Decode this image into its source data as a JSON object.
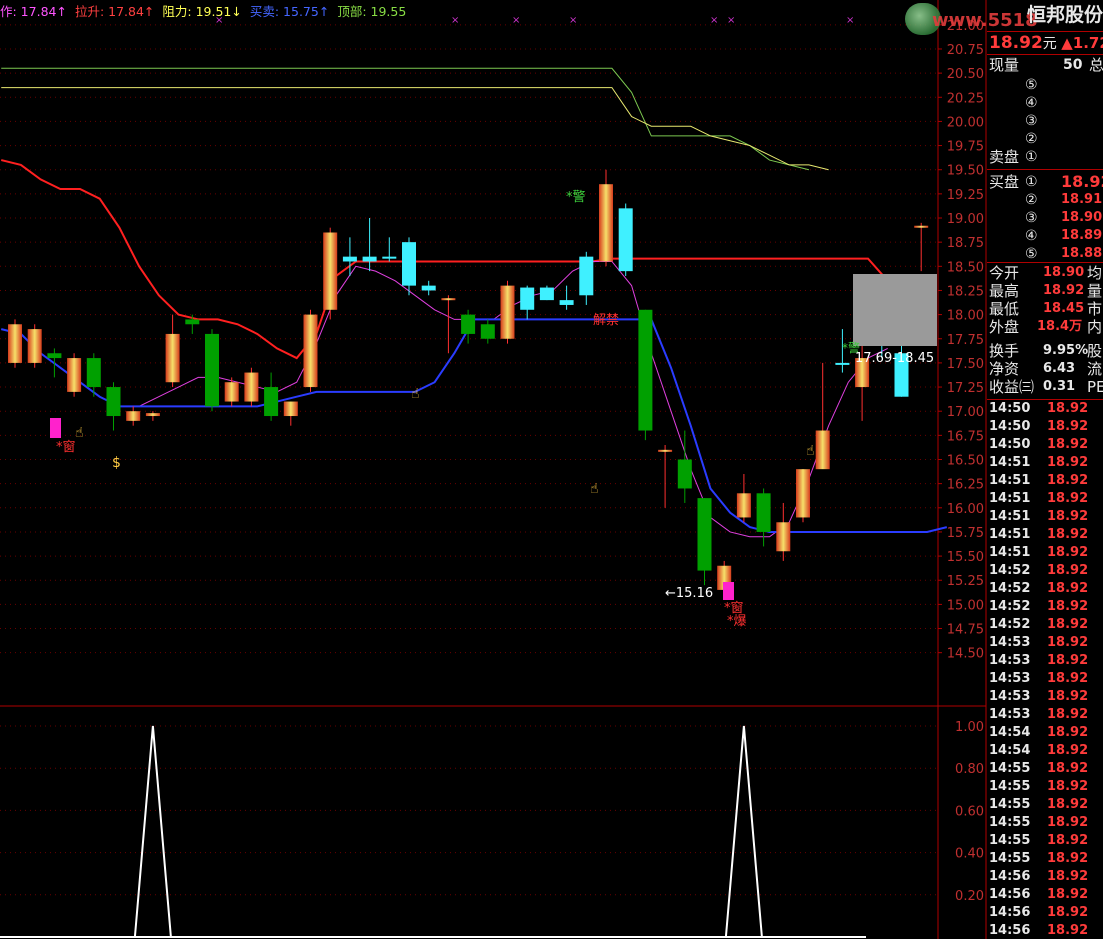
{
  "legend": [
    {
      "text": "作: 17.84↑",
      "color": "#ff55ff"
    },
    {
      "text": "拉升: 17.84↑",
      "color": "#ff4040"
    },
    {
      "text": "阻力: 19.51↓",
      "color": "#ffff55"
    },
    {
      "text": "买卖: 15.75↑",
      "color": "#4466ff"
    },
    {
      "text": "顶部: 19.55",
      "color": "#88dd44"
    }
  ],
  "watermark": "www.5518",
  "stock_name": "恒邦股份",
  "quote": {
    "price": "18.92",
    "unit": "元",
    "change": "▲1.72"
  },
  "volume_row": {
    "label": "现量",
    "value": "50",
    "tail": "总"
  },
  "sell_levels": [
    "⑤",
    "④",
    "③",
    "②",
    "①"
  ],
  "sell_label": "卖盘",
  "buy_label": "买盘",
  "buy_levels": [
    {
      "no": "①",
      "price": "18.92"
    },
    {
      "no": "②",
      "price": "18.91"
    },
    {
      "no": "③",
      "price": "18.90"
    },
    {
      "no": "④",
      "price": "18.89"
    },
    {
      "no": "⑤",
      "price": "18.88"
    }
  ],
  "stats": [
    {
      "label": "今开",
      "value": "18.90",
      "tail": "均",
      "color": "#ff3b3b"
    },
    {
      "label": "最高",
      "value": "18.92",
      "tail": "量",
      "color": "#ff3b3b"
    },
    {
      "label": "最低",
      "value": "18.45",
      "tail": "市",
      "color": "#ff3b3b"
    },
    {
      "label": "外盘",
      "value": "18.4万",
      "tail": "内",
      "color": "#ff3b3b"
    },
    {
      "label": "换手",
      "value": "9.95%",
      "tail": "股",
      "color": "#e8e8e8"
    },
    {
      "label": "净资",
      "value": "6.43",
      "tail": "流",
      "color": "#e8e8e8"
    },
    {
      "label": "收益㈢",
      "value": "0.31",
      "tail": "PE",
      "color": "#e8e8e8"
    }
  ],
  "ticks": [
    {
      "time": "14:50",
      "price": "18.92"
    },
    {
      "time": "14:50",
      "price": "18.92"
    },
    {
      "time": "14:50",
      "price": "18.92"
    },
    {
      "time": "14:51",
      "price": "18.92"
    },
    {
      "time": "14:51",
      "price": "18.92"
    },
    {
      "time": "14:51",
      "price": "18.92"
    },
    {
      "time": "14:51",
      "price": "18.92"
    },
    {
      "time": "14:51",
      "price": "18.92"
    },
    {
      "time": "14:51",
      "price": "18.92"
    },
    {
      "time": "14:52",
      "price": "18.92"
    },
    {
      "time": "14:52",
      "price": "18.92"
    },
    {
      "time": "14:52",
      "price": "18.92"
    },
    {
      "time": "14:52",
      "price": "18.92"
    },
    {
      "time": "14:53",
      "price": "18.92"
    },
    {
      "time": "14:53",
      "price": "18.92"
    },
    {
      "time": "14:53",
      "price": "18.92"
    },
    {
      "time": "14:53",
      "price": "18.92"
    },
    {
      "time": "14:53",
      "price": "18.92"
    },
    {
      "time": "14:54",
      "price": "18.92"
    },
    {
      "time": "14:54",
      "price": "18.92"
    },
    {
      "time": "14:55",
      "price": "18.92"
    },
    {
      "time": "14:55",
      "price": "18.92"
    },
    {
      "time": "14:55",
      "price": "18.92"
    },
    {
      "time": "14:55",
      "price": "18.92"
    },
    {
      "time": "14:55",
      "price": "18.92"
    },
    {
      "time": "14:55",
      "price": "18.92"
    },
    {
      "time": "14:56",
      "price": "18.92"
    },
    {
      "time": "14:56",
      "price": "18.92"
    },
    {
      "time": "14:56",
      "price": "18.92"
    },
    {
      "time": "14:56",
      "price": "18.92"
    }
  ],
  "annotations": {
    "warn1": "*警",
    "warn2": "*警",
    "ban": "解禁",
    "window1": "*窗",
    "window2": "*窗",
    "burst": "*爆",
    "range_label": "17.69-18.45",
    "low_label": "←15.16"
  },
  "colors": {
    "up": "#ff3030",
    "down": "#00a000",
    "cyan": "#3ff0ff",
    "ma_red": "#ff2020",
    "ma_blue": "#2a3cff",
    "ma_magenta": "#e040e0",
    "resist_yellow": "#e8e870",
    "top_green": "#7cc850"
  },
  "chart_data": {
    "type": "candlestick",
    "price_axis": {
      "ticks": [
        "21.00",
        "20.75",
        "20.50",
        "20.25",
        "20.00",
        "19.75",
        "19.50",
        "19.25",
        "19.00",
        "18.75",
        "18.50",
        "18.25",
        "18.00",
        "17.75",
        "17.50",
        "17.25",
        "17.00",
        "16.75",
        "16.50",
        "16.25",
        "16.00",
        "15.75",
        "15.50",
        "15.25",
        "15.00",
        "14.75",
        "14.50"
      ],
      "min": 14.3,
      "max": 21.05
    },
    "indicator_axis": {
      "ticks": [
        "1.00",
        "0.80",
        "0.60",
        "0.40",
        "0.20"
      ],
      "min": 0,
      "max": 1.0
    },
    "candles": [
      {
        "o": 17.9,
        "h": 17.95,
        "l": 17.45,
        "c": 17.5,
        "style": "up"
      },
      {
        "o": 17.5,
        "h": 17.9,
        "l": 17.45,
        "c": 17.85,
        "style": "up"
      },
      {
        "o": 17.6,
        "h": 17.65,
        "l": 17.35,
        "c": 17.55,
        "style": "down"
      },
      {
        "o": 17.2,
        "h": 17.6,
        "l": 17.15,
        "c": 17.55,
        "style": "up"
      },
      {
        "o": 17.55,
        "h": 17.6,
        "l": 17.15,
        "c": 17.25,
        "style": "down"
      },
      {
        "o": 17.25,
        "h": 17.3,
        "l": 16.8,
        "c": 16.95,
        "style": "down"
      },
      {
        "o": 16.9,
        "h": 17.05,
        "l": 16.85,
        "c": 17.0,
        "style": "up"
      },
      {
        "o": 16.95,
        "h": 17.0,
        "l": 16.9,
        "c": 16.98,
        "style": "up"
      },
      {
        "o": 17.3,
        "h": 18.0,
        "l": 17.25,
        "c": 17.8,
        "style": "up"
      },
      {
        "o": 17.95,
        "h": 18.0,
        "l": 17.8,
        "c": 17.9,
        "style": "down"
      },
      {
        "o": 17.8,
        "h": 17.85,
        "l": 17.0,
        "c": 17.05,
        "style": "down"
      },
      {
        "o": 17.1,
        "h": 17.35,
        "l": 17.05,
        "c": 17.3,
        "style": "up"
      },
      {
        "o": 17.1,
        "h": 17.45,
        "l": 17.05,
        "c": 17.4,
        "style": "up"
      },
      {
        "o": 17.25,
        "h": 17.4,
        "l": 16.9,
        "c": 16.95,
        "style": "down"
      },
      {
        "o": 16.95,
        "h": 17.1,
        "l": 16.85,
        "c": 17.1,
        "style": "up"
      },
      {
        "o": 17.25,
        "h": 18.05,
        "l": 17.2,
        "c": 18.0,
        "style": "up"
      },
      {
        "o": 18.05,
        "h": 18.9,
        "l": 17.95,
        "c": 18.85,
        "style": "up"
      },
      {
        "o": 18.6,
        "h": 18.8,
        "l": 18.4,
        "c": 18.55,
        "style": "cyan"
      },
      {
        "o": 18.55,
        "h": 19.0,
        "l": 18.45,
        "c": 18.6,
        "style": "cyan"
      },
      {
        "o": 18.6,
        "h": 18.8,
        "l": 18.55,
        "c": 18.6,
        "style": "cyan"
      },
      {
        "o": 18.75,
        "h": 18.8,
        "l": 18.2,
        "c": 18.3,
        "style": "cyan"
      },
      {
        "o": 18.3,
        "h": 18.35,
        "l": 18.2,
        "c": 18.25,
        "style": "cyan"
      },
      {
        "o": 18.15,
        "h": 18.2,
        "l": 17.6,
        "c": 18.17,
        "style": "up"
      },
      {
        "o": 18.0,
        "h": 18.05,
        "l": 17.7,
        "c": 17.8,
        "style": "down"
      },
      {
        "o": 17.9,
        "h": 17.95,
        "l": 17.7,
        "c": 17.75,
        "style": "down"
      },
      {
        "o": 17.75,
        "h": 18.35,
        "l": 17.7,
        "c": 18.3,
        "style": "up"
      },
      {
        "o": 18.28,
        "h": 18.3,
        "l": 17.95,
        "c": 18.05,
        "style": "cyan"
      },
      {
        "o": 18.28,
        "h": 18.3,
        "l": 18.15,
        "c": 18.15,
        "style": "cyan"
      },
      {
        "o": 18.1,
        "h": 18.3,
        "l": 18.05,
        "c": 18.15,
        "style": "cyan"
      },
      {
        "o": 18.6,
        "h": 18.65,
        "l": 18.1,
        "c": 18.2,
        "style": "cyan"
      },
      {
        "o": 18.55,
        "h": 19.5,
        "l": 18.5,
        "c": 19.35,
        "style": "up"
      },
      {
        "o": 19.1,
        "h": 19.15,
        "l": 18.4,
        "c": 18.45,
        "style": "cyan"
      },
      {
        "o": 18.05,
        "h": 18.05,
        "l": 16.7,
        "c": 16.8,
        "style": "down"
      },
      {
        "o": 16.6,
        "h": 16.65,
        "l": 16.0,
        "c": 16.58,
        "style": "up"
      },
      {
        "o": 16.5,
        "h": 16.8,
        "l": 16.05,
        "c": 16.2,
        "style": "down"
      },
      {
        "o": 16.1,
        "h": 16.1,
        "l": 15.2,
        "c": 15.35,
        "style": "down"
      },
      {
        "o": 15.15,
        "h": 15.45,
        "l": 15.1,
        "c": 15.4,
        "style": "up"
      },
      {
        "o": 15.9,
        "h": 16.35,
        "l": 15.85,
        "c": 16.15,
        "style": "up"
      },
      {
        "o": 16.15,
        "h": 16.2,
        "l": 15.6,
        "c": 15.75,
        "style": "down"
      },
      {
        "o": 15.85,
        "h": 16.05,
        "l": 15.45,
        "c": 15.55,
        "style": "up"
      },
      {
        "o": 15.9,
        "h": 16.4,
        "l": 15.85,
        "c": 16.4,
        "style": "up"
      },
      {
        "o": 16.8,
        "h": 17.5,
        "l": 16.5,
        "c": 16.4,
        "style": "up"
      },
      {
        "o": 17.5,
        "h": 17.85,
        "l": 17.4,
        "c": 17.5,
        "style": "cyan"
      },
      {
        "o": 17.25,
        "h": 17.85,
        "l": 16.9,
        "c": 17.55,
        "style": "up"
      },
      {
        "o": 17.75,
        "h": 18.15,
        "l": 17.55,
        "c": 17.75,
        "style": "cyan"
      },
      {
        "o": 17.15,
        "h": 17.7,
        "l": 17.15,
        "c": 17.6,
        "style": "cyan"
      },
      {
        "o": 18.92,
        "h": 18.95,
        "l": 18.45,
        "c": 18.92,
        "style": "up"
      }
    ],
    "ma_red": [
      19.6,
      19.55,
      19.4,
      19.3,
      19.3,
      19.2,
      18.9,
      18.5,
      18.2,
      18.0,
      17.95,
      17.95,
      17.9,
      17.8,
      17.65,
      17.55,
      17.8,
      18.4,
      18.55,
      18.55,
      18.55,
      18.55,
      18.55,
      18.55,
      18.55,
      18.55,
      18.55,
      18.55,
      18.55,
      18.55,
      18.55,
      18.58,
      18.58,
      18.58,
      18.58,
      18.58,
      18.58,
      18.58,
      18.58,
      18.58,
      18.58,
      18.58,
      18.58,
      18.58,
      18.58,
      18.35,
      17.9
    ],
    "ma_blue": [
      17.85,
      17.8,
      17.6,
      17.45,
      17.3,
      17.15,
      17.05,
      17.05,
      17.05,
      17.05,
      17.05,
      17.05,
      17.05,
      17.05,
      17.1,
      17.15,
      17.2,
      17.2,
      17.2,
      17.2,
      17.2,
      17.2,
      17.3,
      17.6,
      17.95,
      17.95,
      17.95,
      17.95,
      17.95,
      17.95,
      17.95,
      17.95,
      17.95,
      17.95,
      17.45,
      16.85,
      16.2,
      15.95,
      15.8,
      15.75,
      15.75,
      15.75,
      15.75,
      15.75,
      15.75,
      15.75,
      15.75,
      15.75,
      15.8
    ],
    "ma_magenta": [
      null,
      null,
      null,
      null,
      null,
      null,
      17.05,
      17.05,
      17.15,
      17.25,
      17.35,
      17.35,
      17.3,
      17.25,
      17.2,
      17.3,
      17.7,
      18.2,
      18.5,
      18.45,
      18.35,
      18.2,
      18.05,
      17.95,
      17.95,
      17.95,
      18.1,
      18.2,
      18.25,
      18.45,
      18.55,
      18.55,
      18.3,
      17.6,
      17.0,
      16.4,
      15.9,
      15.75,
      15.7,
      15.7,
      15.85,
      16.3,
      16.85,
      17.3,
      17.55,
      17.65
    ],
    "resist_yellow": [
      20.35,
      20.35,
      20.35,
      20.35,
      20.35,
      20.35,
      20.35,
      20.35,
      20.35,
      20.35,
      20.35,
      20.35,
      20.35,
      20.35,
      20.35,
      20.35,
      20.35,
      20.35,
      20.35,
      20.35,
      20.35,
      20.35,
      20.35,
      20.35,
      20.35,
      20.35,
      20.35,
      20.35,
      20.35,
      20.35,
      20.35,
      20.35,
      20.05,
      19.95,
      19.95,
      19.95,
      19.85,
      19.8,
      19.75,
      19.65,
      19.55,
      19.55,
      19.5
    ],
    "top_green": [
      20.55,
      20.55,
      20.55,
      20.55,
      20.55,
      20.55,
      20.55,
      20.55,
      20.55,
      20.55,
      20.55,
      20.55,
      20.55,
      20.55,
      20.55,
      20.55,
      20.55,
      20.55,
      20.55,
      20.55,
      20.55,
      20.55,
      20.55,
      20.55,
      20.55,
      20.55,
      20.55,
      20.55,
      20.55,
      20.55,
      20.55,
      20.55,
      20.3,
      19.85,
      19.85,
      19.85,
      19.85,
      19.85,
      19.75,
      19.6,
      19.55,
      19.5
    ],
    "indicator_peaks": [
      7,
      37
    ]
  }
}
